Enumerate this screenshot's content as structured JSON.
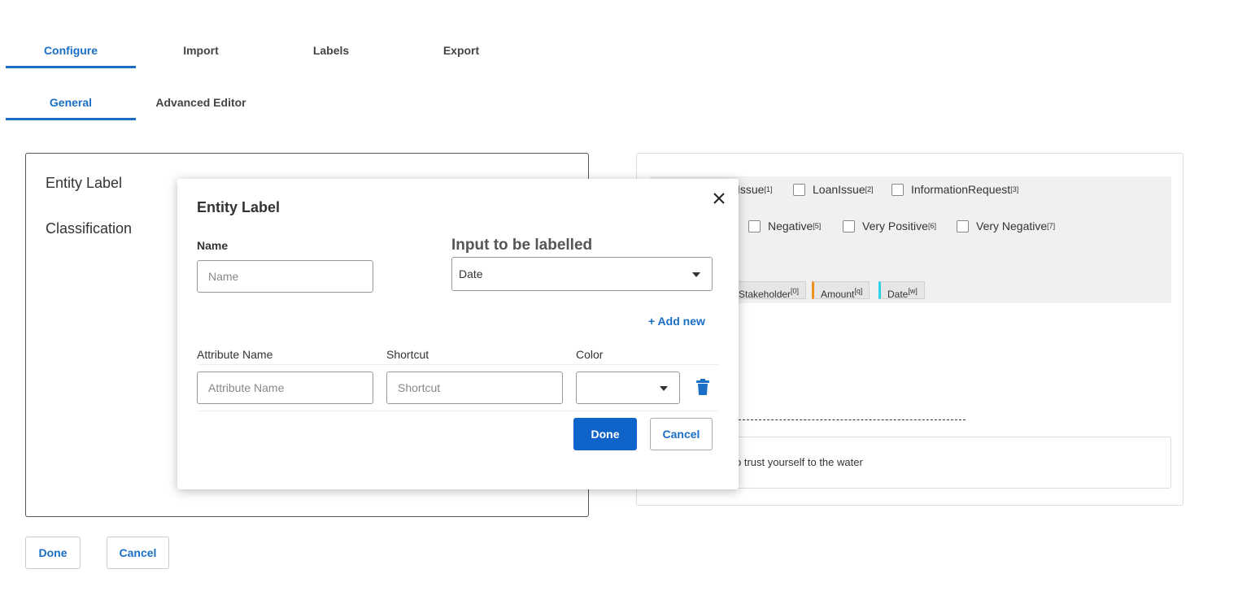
{
  "tabs": [
    {
      "label": "Configure",
      "active": true
    },
    {
      "label": "Import",
      "active": false
    },
    {
      "label": "Labels",
      "active": false
    },
    {
      "label": "Export",
      "active": false
    }
  ],
  "subtabs": [
    {
      "label": "General",
      "active": true
    },
    {
      "label": "Advanced Editor",
      "active": false
    }
  ],
  "left_panel": {
    "rows": [
      "Entity Label",
      "Classification"
    ]
  },
  "footer": {
    "done_label": "Done",
    "cancel_label": "Cancel"
  },
  "right_panel": {
    "row1": [
      {
        "label": "Issue",
        "key": "[1]"
      },
      {
        "label": "LoanIssue",
        "key": "[2]"
      },
      {
        "label": "InformationRequest",
        "key": "[3]"
      }
    ],
    "row2": [
      {
        "label": "Negative",
        "key": "[5]"
      },
      {
        "label": "Very Positive",
        "key": "[6]"
      },
      {
        "label": "Very Negative",
        "key": "[7]"
      }
    ],
    "chips": [
      {
        "label": "Stakeholder",
        "key": "[0]",
        "color": ""
      },
      {
        "label": "Amount",
        "key": "[q]",
        "color": "#f0901e"
      },
      {
        "label": "Date",
        "key": "[w]",
        "color": "#2ad4e6"
      }
    ],
    "text": "o trust yourself to the water"
  },
  "modal": {
    "title": "Entity Label",
    "name_label": "Name",
    "name_placeholder": "Name",
    "input_label": "Input to be labelled",
    "input_value": "Date",
    "add_new": "+ Add new",
    "attr_name_label": "Attribute Name",
    "shortcut_label": "Shortcut",
    "color_label": "Color",
    "attr_name_placeholder": "Attribute Name",
    "shortcut_placeholder": "Shortcut",
    "color_value": "",
    "done_label": "Done",
    "cancel_label": "Cancel"
  },
  "colors": {
    "accent": "#1a6fc4",
    "primary_button": "#0f63c9",
    "trash": "#1a6fc4"
  }
}
